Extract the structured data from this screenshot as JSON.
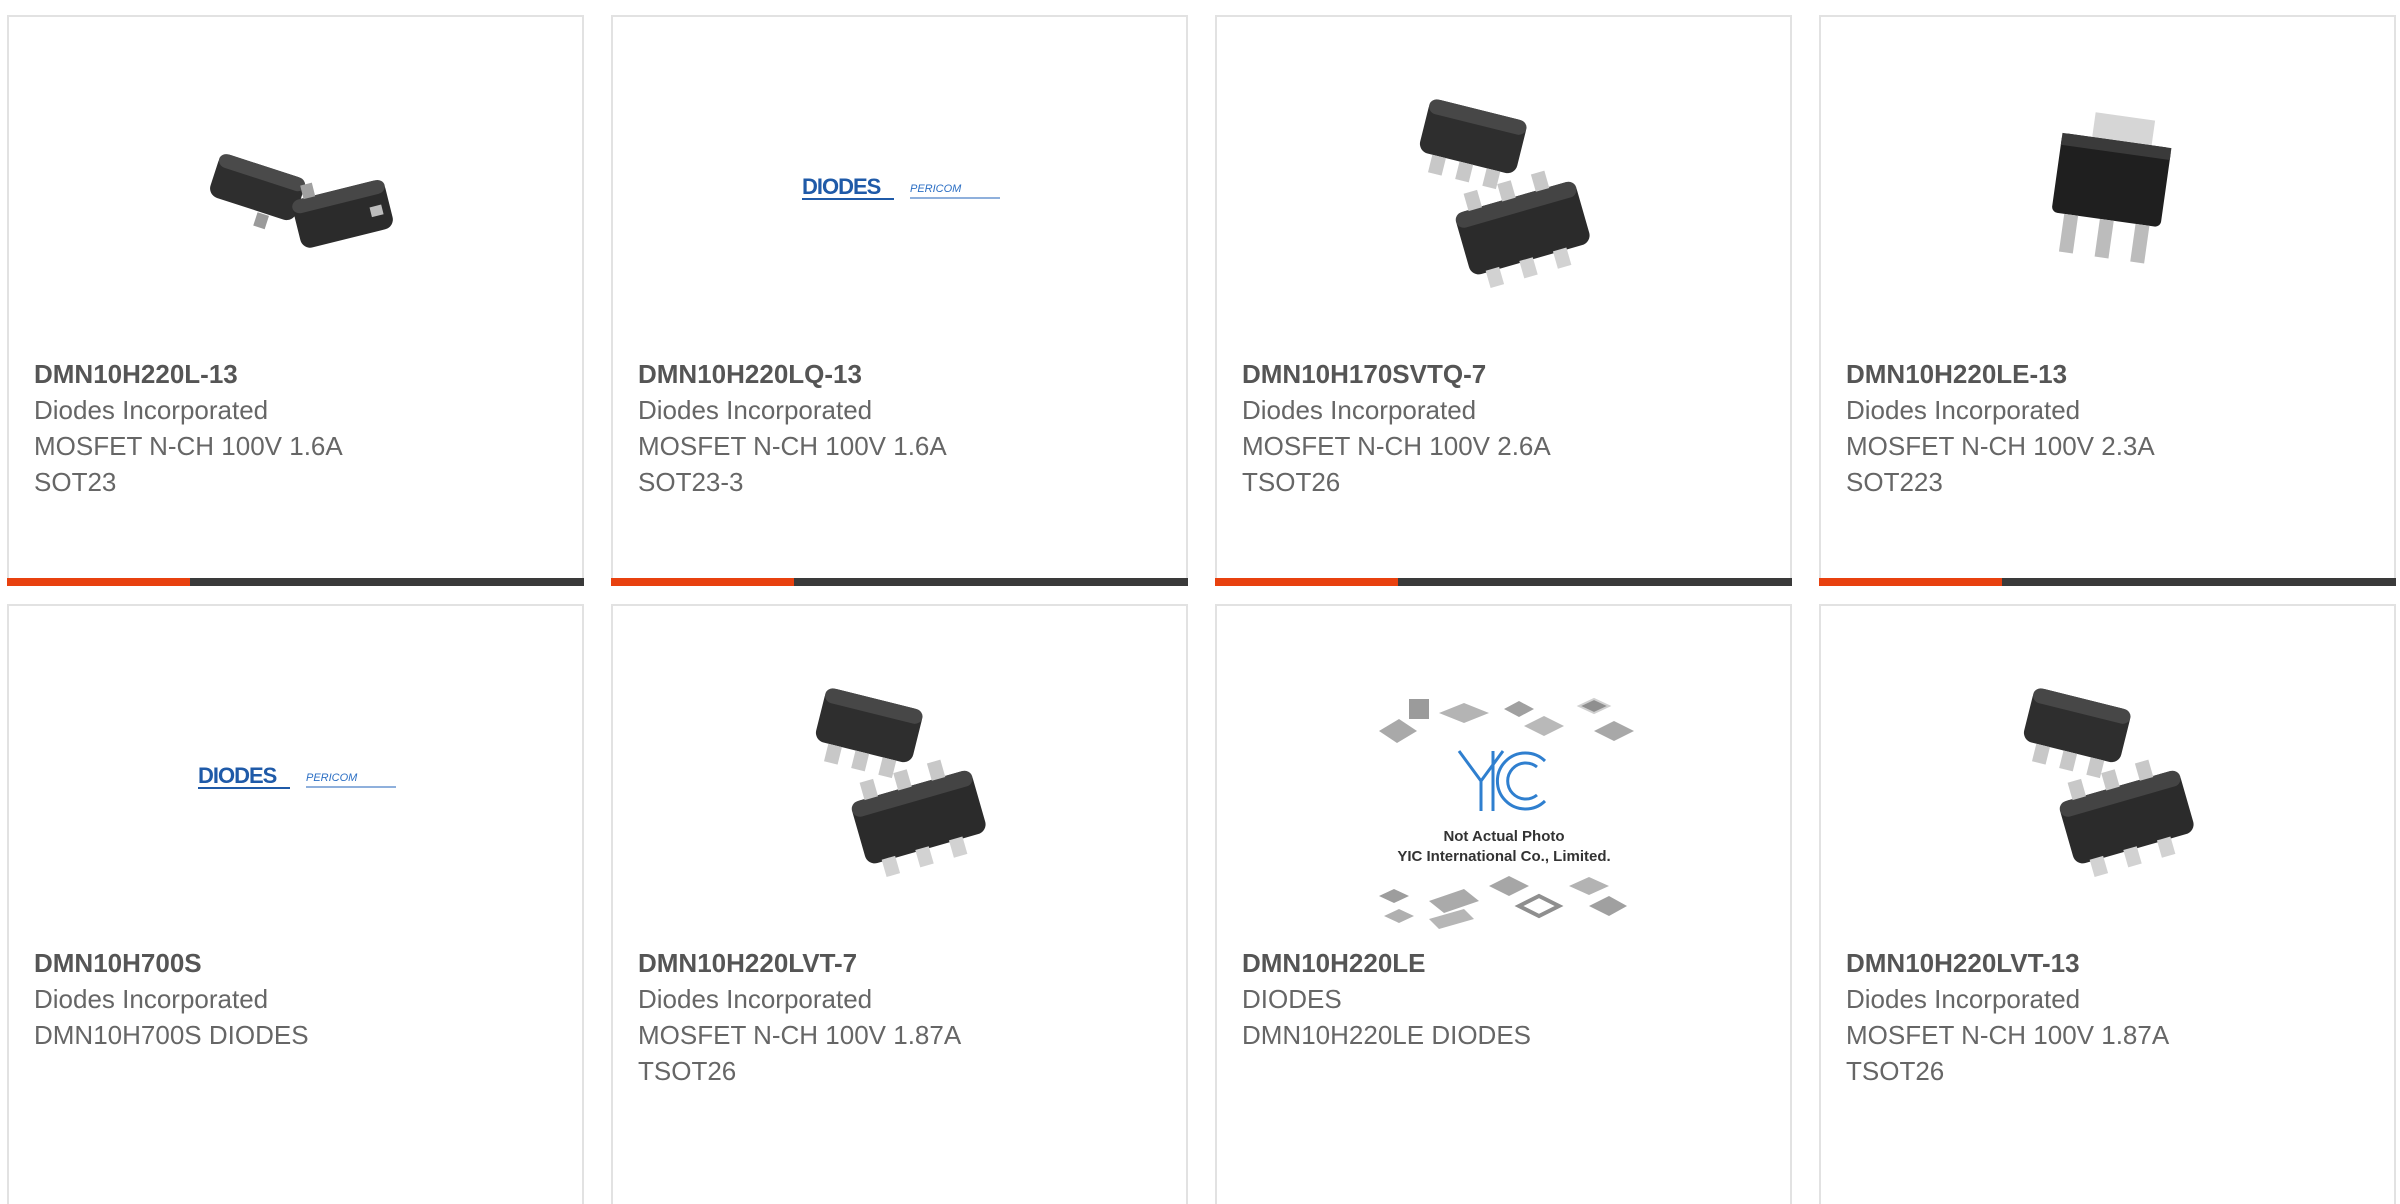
{
  "products": [
    {
      "part_number": "DMN10H220L-13",
      "manufacturer": "Diodes Incorporated",
      "description": "MOSFET N-CH 100V 1.6A",
      "package": "SOT23",
      "image_icon": "sot23-package-icon"
    },
    {
      "part_number": "DMN10H220LQ-13",
      "manufacturer": "Diodes Incorporated",
      "description": "MOSFET N-CH 100V 1.6A",
      "package": "SOT23-3",
      "image_icon": "diodes-pericom-logo",
      "logo_text": "DIODES",
      "logo_subtext": "PERICOM"
    },
    {
      "part_number": "DMN10H170SVTQ-7",
      "manufacturer": "Diodes Incorporated",
      "description": "MOSFET N-CH 100V 2.6A",
      "package": "TSOT26",
      "image_icon": "tsot26-package-icon"
    },
    {
      "part_number": "DMN10H220LE-13",
      "manufacturer": "Diodes Incorporated",
      "description": "MOSFET N-CH 100V 2.3A",
      "package": "SOT223",
      "image_icon": "sot223-package-icon"
    },
    {
      "part_number": "DMN10H700S",
      "manufacturer": "Diodes Incorporated",
      "description": "DMN10H700S DIODES",
      "package": "",
      "image_icon": "diodes-pericom-logo",
      "logo_text": "DIODES",
      "logo_subtext": "PERICOM"
    },
    {
      "part_number": "DMN10H220LVT-7",
      "manufacturer": "Diodes Incorporated",
      "description": "MOSFET N-CH 100V 1.87A",
      "package": "TSOT26",
      "image_icon": "tsot26-package-icon"
    },
    {
      "part_number": "DMN10H220LE",
      "manufacturer": "DIODES",
      "description": "DMN10H220LE DIODES",
      "package": "",
      "image_icon": "yic-placeholder-image",
      "placeholder_logo": "YIC",
      "placeholder_line1": "Not Actual Photo",
      "placeholder_line2": "YIC International Co., Limited."
    },
    {
      "part_number": "DMN10H220LVT-13",
      "manufacturer": "Diodes Incorporated",
      "description": "MOSFET N-CH 100V 1.87A",
      "package": "TSOT26",
      "image_icon": "tsot26-package-icon"
    }
  ],
  "colors": {
    "accent": "#e8410f",
    "bar": "#3a3a3a",
    "border": "#e2e2e2",
    "logo_blue": "#1f5aa8"
  }
}
